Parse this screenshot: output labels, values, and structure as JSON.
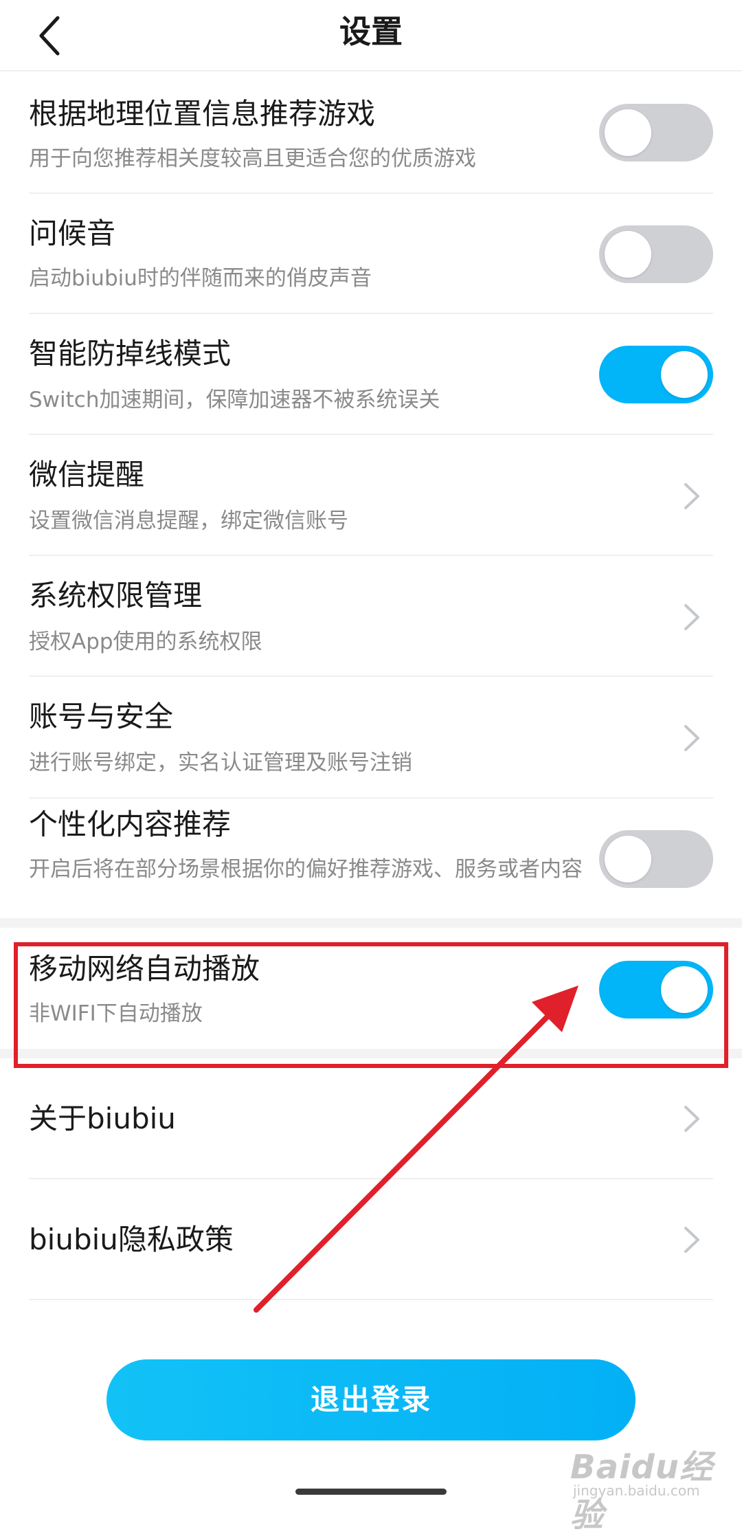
{
  "header": {
    "title": "设置",
    "back_icon": "chevron-left-icon"
  },
  "settings": [
    {
      "title": "根据地理位置信息推荐游戏",
      "subtitle": "用于向您推荐相关度较高且更适合您的优质游戏",
      "control": "toggle",
      "on": false
    },
    {
      "title": "问候音",
      "subtitle": "启动biubiu时的伴随而来的俏皮声音",
      "control": "toggle",
      "on": false
    },
    {
      "title": "智能防掉线模式",
      "subtitle": "Switch加速期间，保障加速器不被系统误关",
      "control": "toggle",
      "on": true
    },
    {
      "title": "微信提醒",
      "subtitle": "设置微信消息提醒，绑定微信账号",
      "control": "chevron"
    },
    {
      "title": "系统权限管理",
      "subtitle": "授权App使用的系统权限",
      "control": "chevron"
    },
    {
      "title": "账号与安全",
      "subtitle": "进行账号绑定，实名认证管理及账号注销",
      "control": "chevron"
    },
    {
      "title": "个性化内容推荐",
      "subtitle": "开启后将在部分场景根据你的偏好推荐游戏、服务或者内容",
      "control": "toggle",
      "on": false
    },
    {
      "title": "移动网络自动播放",
      "subtitle": "非WIFI下自动播放",
      "control": "toggle",
      "on": true
    },
    {
      "title": "关于biubiu",
      "control": "chevron"
    },
    {
      "title": "biubiu隐私政策",
      "control": "chevron"
    }
  ],
  "logout_label": "退出登录",
  "watermark": {
    "main": "Baidu经验",
    "sub": "jingyan.baidu.com"
  },
  "colors": {
    "accent": "#02b4f8",
    "toggle_off": "#cfd0d4",
    "annotation": "#e0202a"
  }
}
